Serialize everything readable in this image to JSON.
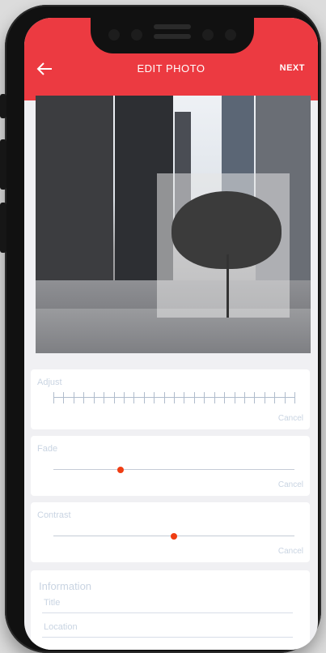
{
  "header": {
    "title": "EDIT PHOTO",
    "next_label": "NEXT",
    "back_icon": "arrow-left-icon"
  },
  "adjust": {
    "label": "Adjust",
    "cancel": "Cancel"
  },
  "fade": {
    "label": "Fade",
    "cancel": "Cancel",
    "value": 0.28
  },
  "contrast": {
    "label": "Contrast",
    "cancel": "Cancel",
    "value": 0.5
  },
  "information": {
    "title": "Information",
    "fields": [
      {
        "label": "Title"
      },
      {
        "label": "Location"
      }
    ]
  },
  "colors": {
    "accent": "#ec3a41",
    "knob": "#ef3d13"
  }
}
